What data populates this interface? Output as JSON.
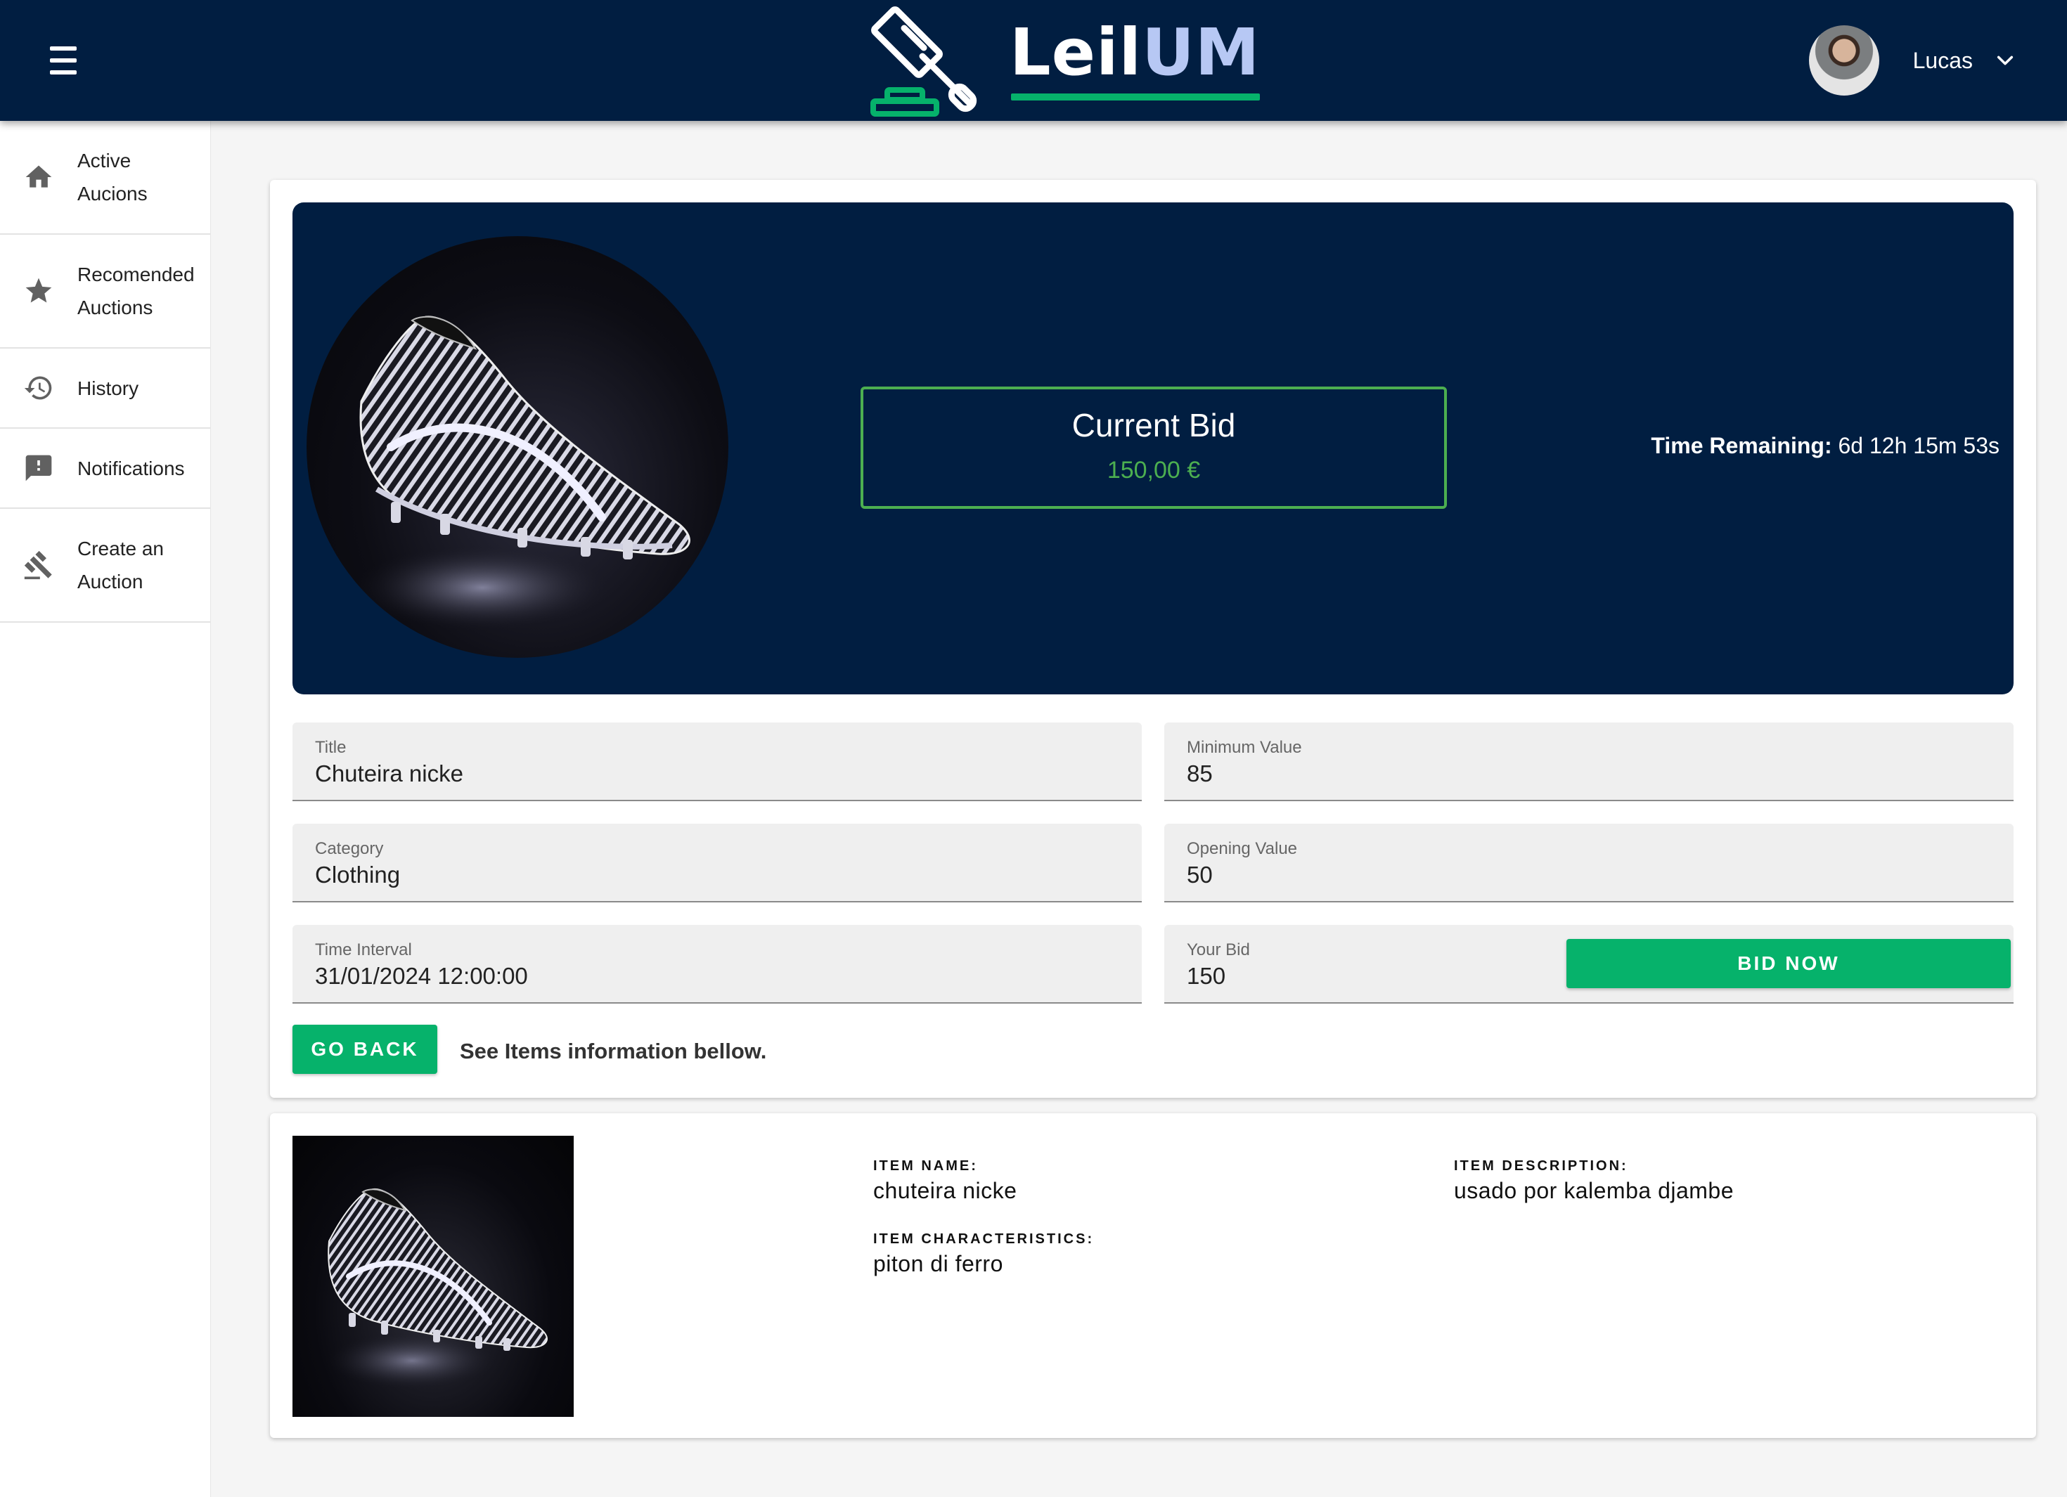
{
  "header": {
    "brand_left": "Leil",
    "brand_right": "UM",
    "user_name": "Lucas",
    "icons": {
      "menu": "hamburger-menu-icon",
      "logo": "gavel-icon",
      "dropdown": "chevron-down-icon"
    }
  },
  "sidebar": {
    "items": [
      {
        "label": "Active Aucions",
        "icon": "home-icon"
      },
      {
        "label": "Recomended Auctions",
        "icon": "star-icon"
      },
      {
        "label": "History",
        "icon": "history-icon"
      },
      {
        "label": "Notifications",
        "icon": "feedback-icon"
      },
      {
        "label": "Create an Auction",
        "icon": "gavel-icon"
      }
    ]
  },
  "auction": {
    "current_bid_label": "Current Bid",
    "current_bid_value": "150,00 €",
    "time_remaining_label": "Time Remaining:",
    "time_remaining_value": "6d 12h 15m 53s",
    "fields": {
      "title": {
        "label": "Title",
        "value": "Chuteira nicke"
      },
      "minimum_value": {
        "label": "Minimum Value",
        "value": "85"
      },
      "category": {
        "label": "Category",
        "value": "Clothing"
      },
      "opening_value": {
        "label": "Opening Value",
        "value": "50"
      },
      "time_interval": {
        "label": "Time Interval",
        "value": "31/01/2024 12:00:00"
      },
      "your_bid": {
        "label": "Your Bid",
        "value": "150"
      }
    },
    "bid_button": "BID NOW",
    "go_back_button": "GO BACK",
    "info_hint": "See Items information bellow."
  },
  "item": {
    "name_label": "ITEM NAME:",
    "name_value": "chuteira nicke",
    "characteristics_label": "ITEM CHARACTERISTICS:",
    "characteristics_value": "piton di ferro",
    "description_label": "ITEM DESCRIPTION:",
    "description_value": "usado por kalemba djambe"
  },
  "colors": {
    "navy": "#011e41",
    "accent_green": "#06b26b",
    "bid_green": "#4caf50",
    "logo_um": "#b7c8f4"
  }
}
